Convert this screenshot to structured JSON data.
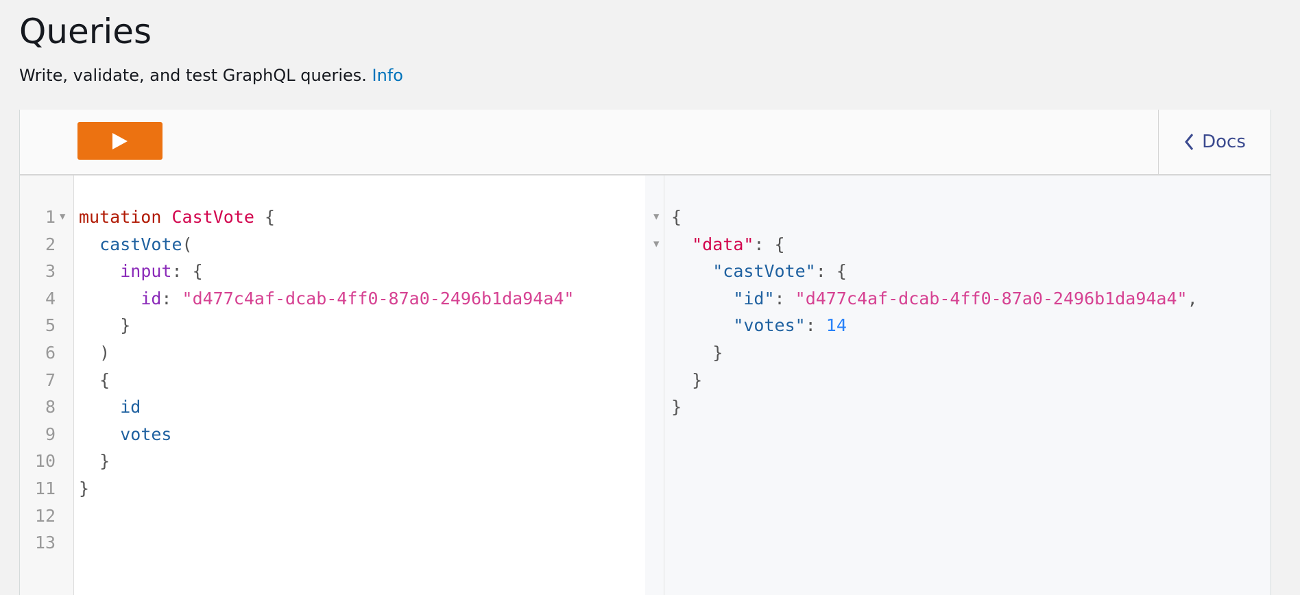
{
  "header": {
    "title": "Queries",
    "subtitle": "Write, validate, and test GraphQL queries.",
    "info_link": "Info"
  },
  "toolbar": {
    "run_icon": "play-icon",
    "docs_label": "Docs",
    "docs_icon": "chevron-left-icon"
  },
  "colors": {
    "run_button": "#ec7211",
    "link": "#0073bb",
    "docs": "#3b4a8f"
  },
  "editor": {
    "line_numbers": [
      "1",
      "2",
      "3",
      "4",
      "5",
      "6",
      "7",
      "8",
      "9",
      "10",
      "11",
      "12",
      "13"
    ],
    "lines": [
      [
        [
          "kw",
          "mutation"
        ],
        [
          "pun",
          " "
        ],
        [
          "def",
          "CastVote"
        ],
        [
          "pun",
          " {"
        ]
      ],
      [
        [
          "pun",
          "  "
        ],
        [
          "prop",
          "castVote"
        ],
        [
          "pun",
          "("
        ]
      ],
      [
        [
          "pun",
          "    "
        ],
        [
          "attr",
          "input"
        ],
        [
          "pun",
          ": {"
        ]
      ],
      [
        [
          "pun",
          "      "
        ],
        [
          "attr",
          "id"
        ],
        [
          "pun",
          ": "
        ],
        [
          "str",
          "\"d477c4af-dcab-4ff0-87a0-2496b1da94a4\""
        ]
      ],
      [
        [
          "pun",
          "    }"
        ]
      ],
      [
        [
          "pun",
          "  )"
        ]
      ],
      [
        [
          "pun",
          "  {"
        ]
      ],
      [
        [
          "pun",
          "    "
        ],
        [
          "prop",
          "id"
        ]
      ],
      [
        [
          "pun",
          "    "
        ],
        [
          "prop",
          "votes"
        ]
      ],
      [
        [
          "pun",
          "  }"
        ]
      ],
      [
        [
          "pun",
          "}"
        ]
      ],
      [],
      []
    ]
  },
  "result": {
    "lines": [
      [
        [
          "pun",
          "{"
        ]
      ],
      [
        [
          "pun",
          "  "
        ],
        [
          "def",
          "\"data\""
        ],
        [
          "pun",
          ": {"
        ]
      ],
      [
        [
          "pun",
          "    "
        ],
        [
          "prop",
          "\"castVote\""
        ],
        [
          "pun",
          ": {"
        ]
      ],
      [
        [
          "pun",
          "      "
        ],
        [
          "prop",
          "\"id\""
        ],
        [
          "pun",
          ": "
        ],
        [
          "str",
          "\"d477c4af-dcab-4ff0-87a0-2496b1da94a4\""
        ],
        [
          "pun",
          ","
        ]
      ],
      [
        [
          "pun",
          "      "
        ],
        [
          "prop",
          "\"votes\""
        ],
        [
          "pun",
          ": "
        ],
        [
          "num",
          "14"
        ]
      ],
      [
        [
          "pun",
          "    }"
        ]
      ],
      [
        [
          "pun",
          "  }"
        ]
      ],
      [
        [
          "pun",
          "}"
        ]
      ]
    ]
  }
}
